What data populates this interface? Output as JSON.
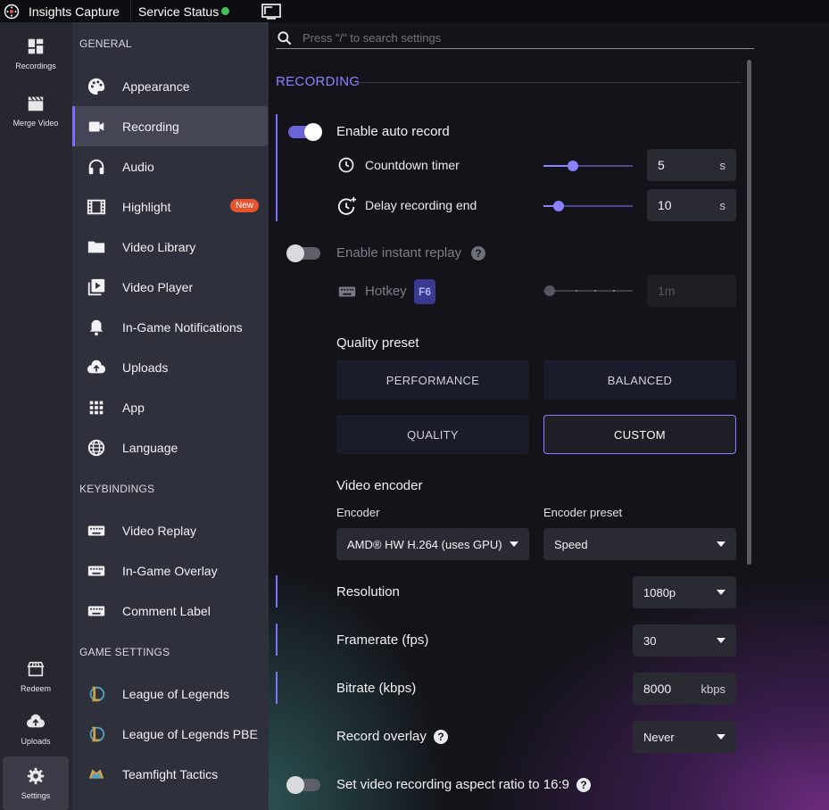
{
  "topbar": {
    "app_title": "Insights Capture",
    "service_status_label": "Service Status",
    "service_status_color": "#3ec25a"
  },
  "rail": {
    "items": [
      {
        "label": "Recordings",
        "icon": "dashboard-icon"
      },
      {
        "label": "Merge Video",
        "icon": "clapperboard-icon"
      },
      {
        "label": "Redeem",
        "icon": "store-icon"
      },
      {
        "label": "Uploads",
        "icon": "cloud-upload-icon"
      },
      {
        "label": "Settings",
        "icon": "gear-icon",
        "active": true
      }
    ]
  },
  "nav": {
    "general_header": "GENERAL",
    "general_items": [
      {
        "label": "Appearance",
        "icon": "palette-icon"
      },
      {
        "label": "Recording",
        "icon": "videocam-icon",
        "active": true
      },
      {
        "label": "Audio",
        "icon": "headphones-icon"
      },
      {
        "label": "Highlight",
        "icon": "film-icon",
        "badge": "New"
      },
      {
        "label": "Video Library",
        "icon": "folder-icon"
      },
      {
        "label": "Video Player",
        "icon": "video-library-icon"
      },
      {
        "label": "In-Game Notifications",
        "icon": "bell-icon"
      },
      {
        "label": "Uploads",
        "icon": "cloud-upload-icon"
      },
      {
        "label": "App",
        "icon": "apps-grid-icon"
      },
      {
        "label": "Language",
        "icon": "globe-icon"
      }
    ],
    "keybindings_header": "KEYBINDINGS",
    "keybinding_items": [
      {
        "label": "Video Replay",
        "icon": "keyboard-icon"
      },
      {
        "label": "In-Game Overlay",
        "icon": "keyboard-icon"
      },
      {
        "label": "Comment Label",
        "icon": "keyboard-icon"
      }
    ],
    "game_header": "GAME SETTINGS",
    "game_items": [
      {
        "label": "League of Legends",
        "icon": "league-of-legends-icon"
      },
      {
        "label": "League of Legends PBE",
        "icon": "league-of-legends-pbe-icon"
      },
      {
        "label": "Teamfight Tactics",
        "icon": "teamfight-tactics-icon"
      }
    ]
  },
  "main": {
    "search_placeholder": "Press \"/\" to search settings",
    "section_title": "RECORDING",
    "auto_record": {
      "label": "Enable auto record",
      "enabled": true
    },
    "countdown": {
      "label": "Countdown timer",
      "value": "5",
      "unit": "s",
      "slider_fraction": 0.33
    },
    "delay_end": {
      "label": "Delay recording end",
      "value": "10",
      "unit": "s",
      "slider_fraction": 0.15
    },
    "instant_replay": {
      "label": "Enable instant replay",
      "enabled": false
    },
    "hotkey": {
      "label": "Hotkey",
      "key": "F6",
      "value": "1m",
      "slider_fraction": 0.0
    },
    "quality_preset": {
      "label": "Quality preset",
      "options": [
        "PERFORMANCE",
        "BALANCED",
        "QUALITY",
        "CUSTOM"
      ],
      "selected": "CUSTOM"
    },
    "video_encoder": {
      "title": "Video encoder",
      "encoder_label": "Encoder",
      "encoder_value": "AMD® HW H.264 (uses GPU)",
      "preset_label": "Encoder preset",
      "preset_value": "Speed"
    },
    "resolution": {
      "label": "Resolution",
      "value": "1080p"
    },
    "framerate": {
      "label": "Framerate (fps)",
      "value": "30"
    },
    "bitrate": {
      "label": "Bitrate (kbps)",
      "value": "8000",
      "unit": "kbps"
    },
    "record_overlay": {
      "label": "Record overlay",
      "value": "Never"
    },
    "aspect_ratio": {
      "label": "Set video recording aspect ratio to 16:9",
      "enabled": false
    }
  },
  "colors": {
    "accent": "#7b73ff",
    "badge": "#e8532f"
  }
}
